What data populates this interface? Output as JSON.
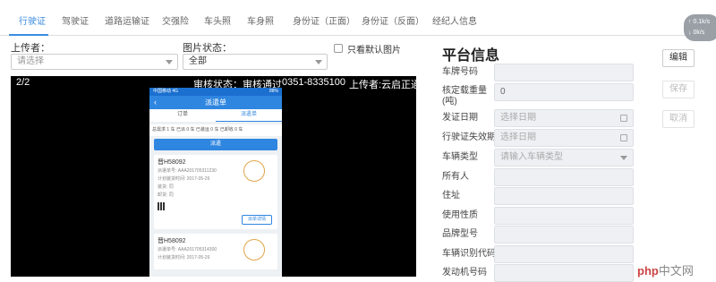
{
  "tabs": [
    "行驶证",
    "驾驶证",
    "道路运输证",
    "交强险",
    "车头照",
    "车身照",
    "身份证（正面）",
    "身份证（反面）",
    "经纪人信息"
  ],
  "status_widget": {
    "line1": "↑ 0.1k/s",
    "line2": "↓ 0k/s"
  },
  "uploader": {
    "label": "上传者：",
    "placeholder": "请选择"
  },
  "image_status": {
    "label": "图片状态：",
    "value": "全部"
  },
  "default_only": {
    "label": "只看默认图片"
  },
  "viewer": {
    "counter": "2/2",
    "review_status": "审核状态：审核通过",
    "phone": "0351-8335100",
    "uploader": "上传者:云启正通"
  },
  "phone_screen": {
    "status_left": "中国移动 4G",
    "status_right": "88%",
    "back": "‹",
    "title": "派遣单",
    "tabs": [
      "订单",
      "派遣单"
    ],
    "stats": "总需求 1 车   已派 0 车   已装运 0 车   已卸收 0 车",
    "dispatch_button": "派遣",
    "cards": [
      {
        "plate": "晋H58092",
        "rows": [
          "派遣单号:    AAA201705311230",
          "计划装货时间:   2017-05-26",
          "装货:   同",
          "卸货:   同"
        ],
        "detail": "派单详情"
      },
      {
        "plate": "晋H58092",
        "rows": [
          "派遣单号:    AAA201705314300",
          "计划装货时间:   2017-05-26"
        ]
      }
    ]
  },
  "platform": {
    "title": "平台信息",
    "fields": [
      {
        "label": "车牌号码",
        "value": ""
      },
      {
        "label": "核定载重量(吨)",
        "value": "0"
      },
      {
        "label": "发证日期",
        "value": "选择日期"
      },
      {
        "label": "行驶证失效期",
        "value": "选择日期"
      },
      {
        "label": "车辆类型",
        "value": "请输入车辆类型"
      },
      {
        "label": "所有人",
        "value": ""
      },
      {
        "label": "住址",
        "value": ""
      },
      {
        "label": "使用性质",
        "value": ""
      },
      {
        "label": "品牌型号",
        "value": ""
      },
      {
        "label": "车辆识别代码",
        "value": ""
      },
      {
        "label": "发动机号码",
        "value": ""
      }
    ]
  },
  "buttons": {
    "edit": "编辑",
    "save": "保存",
    "cancel": "取消"
  },
  "watermark": {
    "brand": "php",
    "site": "中文网"
  },
  "colors": {
    "accent": "#3b8de0",
    "phone_header": "#2f86e0"
  }
}
